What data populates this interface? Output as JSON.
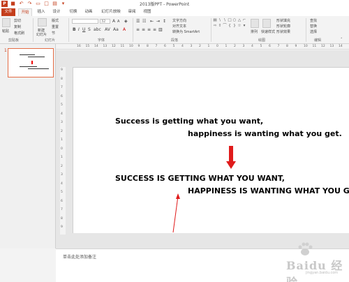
{
  "window": {
    "title": "2013版PPT - PowerPoint",
    "app_icon": "powerpoint-logo",
    "qat_icons": [
      "save-icon",
      "undo-icon",
      "redo-icon",
      "slideshow-icon",
      "new-icon",
      "open-icon",
      "customize-icon"
    ]
  },
  "tabs": [
    "文件",
    "开始",
    "插入",
    "设计",
    "切换",
    "动画",
    "幻灯片放映",
    "审阅",
    "视图"
  ],
  "active_tab": "开始",
  "ribbon": {
    "clipboard": {
      "paste": "粘贴",
      "cut": "剪切",
      "copy": "复制",
      "format_painter": "格式刷",
      "label": "剪贴板"
    },
    "slides": {
      "new_slide": "新建",
      "new_slide_2": "幻灯片",
      "layout": "版式",
      "reset": "重置",
      "section": "节",
      "label": "幻灯片"
    },
    "font": {
      "size": "32",
      "label": "字体"
    },
    "paragraph": {
      "label": "段落",
      "text_direction": "文字方向",
      "align_text": "对齐文本",
      "smartart": "转换为 SmartArt"
    },
    "drawing": {
      "arrange": "排列",
      "quick_styles": "快速样式",
      "label": "绘图"
    },
    "shape_format": {
      "fill": "形状填充",
      "outline": "形状轮廓",
      "effects": "形状效果"
    },
    "editing": {
      "find": "查找",
      "replace": "替换",
      "select": "选择",
      "label": "编辑"
    }
  },
  "thumbnail": {
    "number": "1"
  },
  "ruler": {
    "ticks": [
      "16",
      "15",
      "14",
      "13",
      "12",
      "11",
      "10",
      "9",
      "8",
      "7",
      "6",
      "5",
      "4",
      "3",
      "2",
      "1",
      "0",
      "1",
      "2",
      "3",
      "4",
      "5",
      "6",
      "7",
      "8",
      "9",
      "10",
      "11",
      "12",
      "13",
      "14"
    ]
  },
  "vruler": {
    "ticks": [
      "9",
      "8",
      "7",
      "6",
      "5",
      "4",
      "3",
      "2",
      "1",
      "0",
      "1",
      "2",
      "3",
      "4",
      "5",
      "6",
      "7",
      "8",
      "9"
    ]
  },
  "slide": {
    "line1": "Success is getting what you want,",
    "line2": "happiness is wanting what you get.",
    "line3": "SUCCESS IS GETTING WHAT YOU WANT,",
    "line4": "HAPPINESS IS WANTING WHAT YOU GET.",
    "arrow_color": "#e01b1b"
  },
  "notes": {
    "placeholder": "单击此处添加备注"
  },
  "watermark": {
    "brand": "Baidu 经验",
    "url": "jingyan.baidu.com"
  }
}
